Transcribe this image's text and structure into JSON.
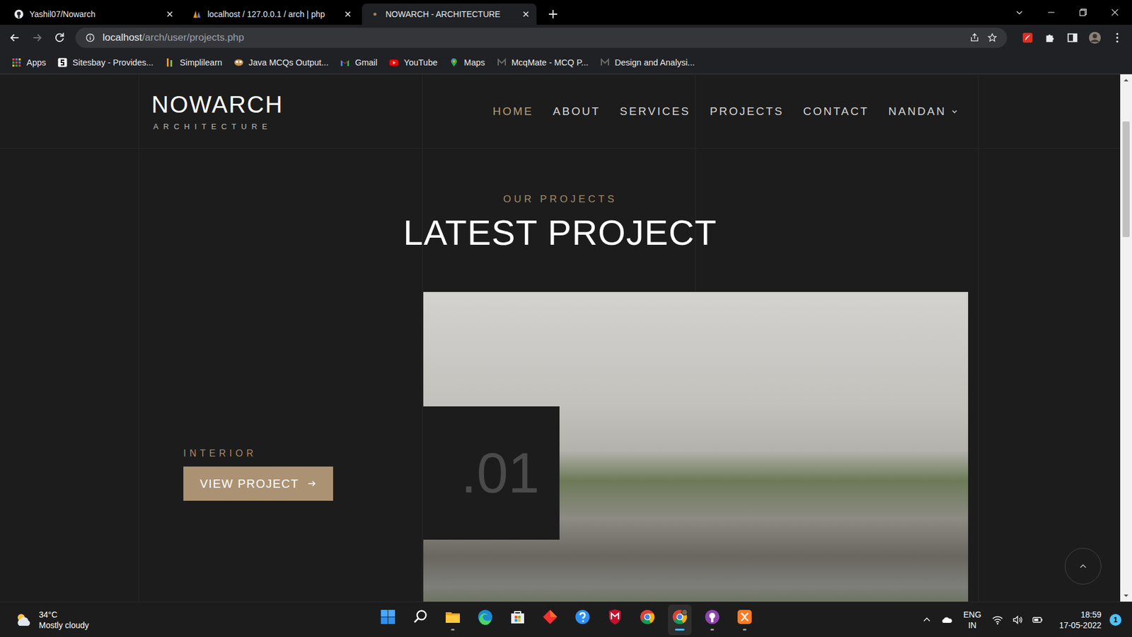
{
  "browser": {
    "tabs": [
      {
        "label": "Yashil07/Nowarch",
        "kind": "github",
        "selected": false
      },
      {
        "label": "localhost / 127.0.0.1 / arch | php",
        "kind": "phpmyadmin",
        "selected": false
      },
      {
        "label": "NOWARCH - ARCHITECTURE",
        "kind": "dot",
        "selected": true
      }
    ],
    "navigation": {
      "back_enabled": true,
      "forward_enabled": false
    },
    "address": {
      "host": "localhost",
      "path": "/arch/user/projects.php"
    },
    "bookmarks": [
      {
        "label": "Apps",
        "kind": "apps"
      },
      {
        "label": "Sitesbay - Provides...",
        "kind": "sitesbay"
      },
      {
        "label": "Simplilearn",
        "kind": "simplilearn"
      },
      {
        "label": "Java MCQs Output...",
        "kind": "java"
      },
      {
        "label": "Gmail",
        "kind": "gmail"
      },
      {
        "label": "YouTube",
        "kind": "youtube"
      },
      {
        "label": "Maps",
        "kind": "maps"
      },
      {
        "label": "McqMate - MCQ P...",
        "kind": "mcqmate"
      },
      {
        "label": "Design and Analysi...",
        "kind": "mcqmate"
      }
    ],
    "scrollbar": {
      "position": 0.07,
      "size": 0.23
    }
  },
  "page": {
    "logo": {
      "name": "NOWARCH",
      "tagline": "ARCHITECTURE"
    },
    "nav": [
      {
        "label": "HOME",
        "kind": "link",
        "selected": true
      },
      {
        "label": "ABOUT",
        "kind": "link",
        "selected": false
      },
      {
        "label": "SERVICES",
        "kind": "link",
        "selected": false
      },
      {
        "label": "PROJECTS",
        "kind": "link",
        "selected": false
      },
      {
        "label": "CONTACT",
        "kind": "link",
        "selected": false
      },
      {
        "label": "NANDAN",
        "kind": "menu",
        "selected": false
      }
    ],
    "section": {
      "eyebrow": "OUR PROJECTS",
      "title": "LATEST PROJECT"
    },
    "project": {
      "category": "INTERIOR",
      "button": "VIEW PROJECT",
      "number": ".01"
    }
  },
  "taskbar": {
    "weather": {
      "temperature": "34°C",
      "condition": "Mostly cloudy"
    },
    "apps": [
      {
        "kind": "start",
        "running": false,
        "active": false
      },
      {
        "kind": "search",
        "running": false,
        "active": false
      },
      {
        "kind": "explorer",
        "running": true,
        "active": false
      },
      {
        "kind": "edge",
        "running": false,
        "active": false
      },
      {
        "kind": "store",
        "running": false,
        "active": false
      },
      {
        "kind": "diamond",
        "running": false,
        "active": false
      },
      {
        "kind": "help",
        "running": false,
        "active": false
      },
      {
        "kind": "mcafee",
        "running": false,
        "active": false
      },
      {
        "kind": "chrome",
        "running": false,
        "active": false
      },
      {
        "kind": "chromeprofile",
        "running": true,
        "active": true
      },
      {
        "kind": "github",
        "running": true,
        "active": false
      },
      {
        "kind": "xampp",
        "running": true,
        "active": false
      }
    ],
    "language": {
      "code": "ENG",
      "region": "IN"
    },
    "clock": {
      "time": "18:59",
      "date": "17-05-2022"
    },
    "notifications": "1"
  }
}
